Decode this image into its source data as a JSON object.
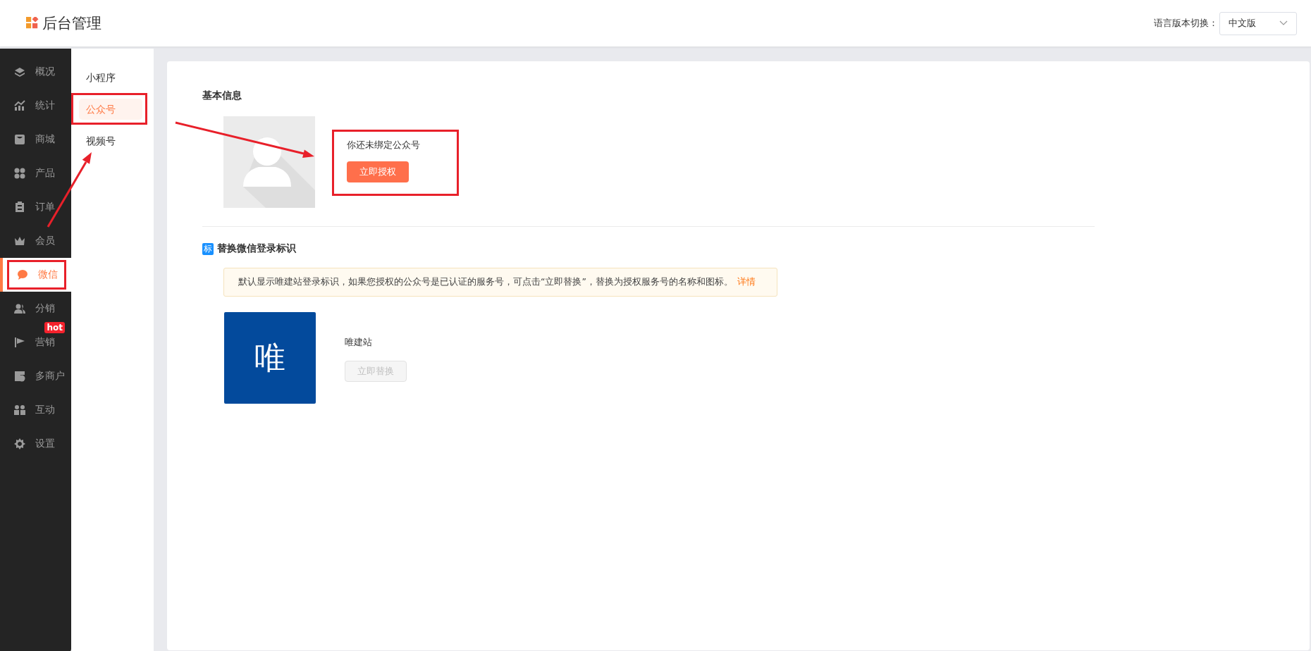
{
  "header": {
    "logo_text": "后台管理",
    "language_label": "语言版本切换：",
    "language_select": {
      "value": "中文版"
    }
  },
  "sidebar": {
    "items": [
      {
        "label": "概况",
        "selected": false,
        "highlighted": false
      },
      {
        "label": "统计",
        "selected": false,
        "highlighted": false
      },
      {
        "label": "商城",
        "selected": false,
        "highlighted": false
      },
      {
        "label": "产品",
        "selected": false,
        "highlighted": false
      },
      {
        "label": "订单",
        "selected": false,
        "highlighted": false
      },
      {
        "label": "会员",
        "selected": false,
        "highlighted": false
      },
      {
        "label": "微信",
        "selected": true,
        "highlighted": true
      },
      {
        "label": "分销",
        "selected": false,
        "highlighted": false
      },
      {
        "label": "营销",
        "selected": false,
        "highlighted": false,
        "badge": "hot"
      },
      {
        "label": "多商户",
        "selected": false,
        "highlighted": false
      },
      {
        "label": "互动",
        "selected": false,
        "highlighted": false
      },
      {
        "label": "设置",
        "selected": false,
        "highlighted": false
      }
    ]
  },
  "subnav": {
    "items": [
      {
        "label": "小程序",
        "selected": false,
        "highlighted": false
      },
      {
        "label": "公众号",
        "selected": true,
        "highlighted": true
      },
      {
        "label": "视频号",
        "selected": false,
        "highlighted": false
      }
    ]
  },
  "basic_info": {
    "title": "基本信息",
    "bind_panel": {
      "message": "你还未绑定公众号",
      "button": "立即授权",
      "highlighted": true
    }
  },
  "login_mark": {
    "title_badge": "标",
    "title": "替换微信登录标识",
    "notice": {
      "text": "默认显示唯建站登录标识，如果您授权的公众号是已认证的服务号，可点击“立即替换”，替换为授权服务号的名称和图标。",
      "link": "详情"
    },
    "brand": {
      "logo_char": "唯",
      "name": "唯建站",
      "button": {
        "label": "立即替换",
        "disabled": true
      }
    }
  }
}
